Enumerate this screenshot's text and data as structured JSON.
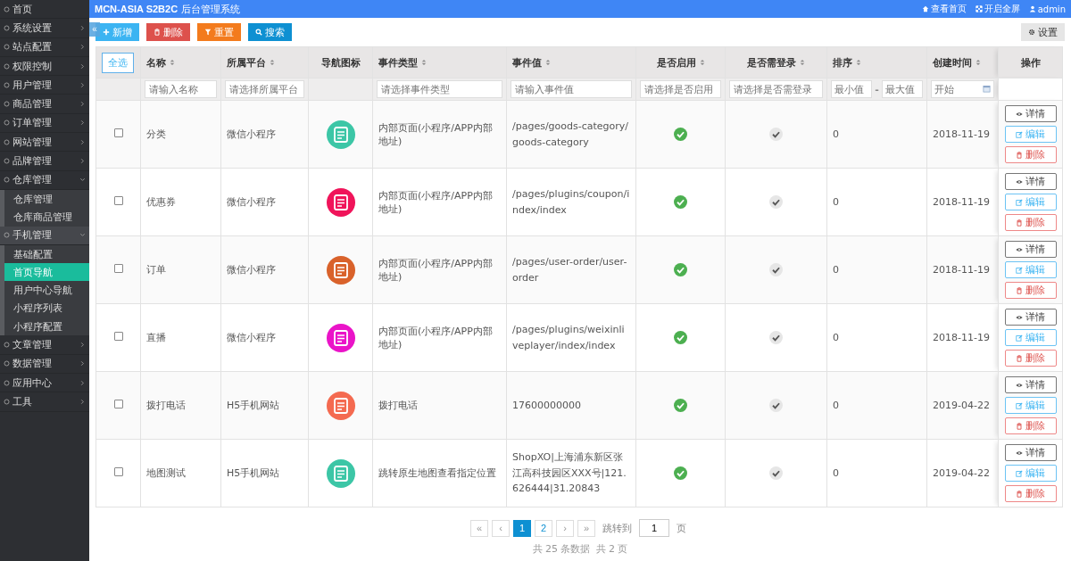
{
  "sidebar": {
    "items": [
      {
        "label": "首页",
        "kind": "link",
        "selected": false,
        "expanded": false
      },
      {
        "label": "系统设置",
        "kind": "group",
        "selected": false,
        "expanded": false
      },
      {
        "label": "站点配置",
        "kind": "group",
        "selected": false,
        "expanded": false
      },
      {
        "label": "权限控制",
        "kind": "group",
        "selected": false,
        "expanded": false
      },
      {
        "label": "用户管理",
        "kind": "group",
        "selected": false,
        "expanded": false
      },
      {
        "label": "商品管理",
        "kind": "group",
        "selected": false,
        "expanded": false
      },
      {
        "label": "订单管理",
        "kind": "group",
        "selected": false,
        "expanded": false
      },
      {
        "label": "网站管理",
        "kind": "group",
        "selected": false,
        "expanded": false
      },
      {
        "label": "品牌管理",
        "kind": "group",
        "selected": false,
        "expanded": false
      },
      {
        "label": "仓库管理",
        "kind": "group",
        "selected": false,
        "expanded": true,
        "children": [
          {
            "label": "仓库管理",
            "selected": false
          },
          {
            "label": "仓库商品管理",
            "selected": false
          }
        ]
      },
      {
        "label": "手机管理",
        "kind": "group",
        "selected": true,
        "expanded": true,
        "children": [
          {
            "label": "基础配置",
            "selected": false
          },
          {
            "label": "首页导航",
            "selected": true
          },
          {
            "label": "用户中心导航",
            "selected": false
          },
          {
            "label": "小程序列表",
            "selected": false
          },
          {
            "label": "小程序配置",
            "selected": false
          }
        ]
      },
      {
        "label": "文章管理",
        "kind": "group",
        "selected": false,
        "expanded": false
      },
      {
        "label": "数据管理",
        "kind": "group",
        "selected": false,
        "expanded": false
      },
      {
        "label": "应用中心",
        "kind": "group",
        "selected": false,
        "expanded": false
      },
      {
        "label": "工具",
        "kind": "group",
        "selected": false,
        "expanded": false
      }
    ]
  },
  "header": {
    "brand": "MCN-ASIA S2B2C",
    "subtitle": "后台管理系统",
    "links": [
      {
        "label": "查看首页",
        "kind": "home"
      },
      {
        "label": "开启全屏",
        "kind": "fullscreen"
      },
      {
        "label": "admin",
        "kind": "user"
      }
    ]
  },
  "toolbar": {
    "collapse": "«",
    "buttons": [
      {
        "label": "新增",
        "kind": "add"
      },
      {
        "label": "删除",
        "kind": "delete"
      },
      {
        "label": "重置",
        "kind": "reset"
      },
      {
        "label": "搜索",
        "kind": "search"
      }
    ],
    "settings": "设置"
  },
  "table": {
    "select_all": "全选",
    "columns": [
      {
        "label": "名称",
        "sortable": true,
        "filter": {
          "kind": "text",
          "placeholder": "请输入名称"
        }
      },
      {
        "label": "所属平台",
        "sortable": true,
        "filter": {
          "kind": "text",
          "placeholder": "请选择所属平台"
        }
      },
      {
        "label": "导航图标",
        "sortable": false,
        "filter": {
          "kind": "none"
        }
      },
      {
        "label": "事件类型",
        "sortable": true,
        "filter": {
          "kind": "text",
          "placeholder": "请选择事件类型"
        }
      },
      {
        "label": "事件值",
        "sortable": true,
        "filter": {
          "kind": "text",
          "placeholder": "请输入事件值"
        }
      },
      {
        "label": "是否启用",
        "sortable": true,
        "filter": {
          "kind": "text",
          "placeholder": "请选择是否启用"
        }
      },
      {
        "label": "是否需登录",
        "sortable": true,
        "filter": {
          "kind": "text",
          "placeholder": "请选择是否需登录"
        }
      },
      {
        "label": "排序",
        "sortable": true,
        "filter": {
          "kind": "range",
          "placeholder": "最小值",
          "placeholder_2": "最大值",
          "separator": "-"
        }
      },
      {
        "label": "创建时间",
        "sortable": true,
        "filter": {
          "kind": "date",
          "placeholder": "开始"
        }
      },
      {
        "label": "操作",
        "sortable": false,
        "filter": {
          "kind": "none"
        }
      }
    ],
    "rows": [
      {
        "checked": false,
        "name": "分类",
        "platform": "微信小程序",
        "color": "#3cc6a6",
        "event_type": "内部页面(小程序/APP内部地址)",
        "event_value": "/pages/goods-category/goods-category",
        "enabled": true,
        "login_required": true,
        "sort": "0",
        "created": "2018-11-19",
        "actions": [
          {
            "label": "详情",
            "kind": "view"
          },
          {
            "label": "编辑",
            "kind": "edit"
          },
          {
            "label": "删除",
            "kind": "delete"
          }
        ]
      },
      {
        "checked": false,
        "name": "优惠券",
        "platform": "微信小程序",
        "color": "#f0145a",
        "event_type": "内部页面(小程序/APP内部地址)",
        "event_value": "/pages/plugins/coupon/index/index",
        "enabled": true,
        "login_required": true,
        "sort": "0",
        "created": "2018-11-19",
        "actions": [
          {
            "label": "详情",
            "kind": "view"
          },
          {
            "label": "编辑",
            "kind": "edit"
          },
          {
            "label": "删除",
            "kind": "delete"
          }
        ]
      },
      {
        "checked": false,
        "name": "订单",
        "platform": "微信小程序",
        "color": "#d9622b",
        "event_type": "内部页面(小程序/APP内部地址)",
        "event_value": "/pages/user-order/user-order",
        "enabled": true,
        "login_required": true,
        "sort": "0",
        "created": "2018-11-19",
        "actions": [
          {
            "label": "详情",
            "kind": "view"
          },
          {
            "label": "编辑",
            "kind": "edit"
          },
          {
            "label": "删除",
            "kind": "delete"
          }
        ]
      },
      {
        "checked": false,
        "name": "直播",
        "platform": "微信小程序",
        "color": "#ea14c8",
        "event_type": "内部页面(小程序/APP内部地址)",
        "event_value": "/pages/plugins/weixinliveplayer/index/index",
        "enabled": true,
        "login_required": true,
        "sort": "0",
        "created": "2018-11-19",
        "actions": [
          {
            "label": "详情",
            "kind": "view"
          },
          {
            "label": "编辑",
            "kind": "edit"
          },
          {
            "label": "删除",
            "kind": "delete"
          }
        ]
      },
      {
        "checked": false,
        "name": "拨打电话",
        "platform": "H5手机网站",
        "color": "#f46a50",
        "event_type": "拨打电话",
        "event_value": "17600000000",
        "enabled": true,
        "login_required": true,
        "sort": "0",
        "created": "2019-04-22",
        "actions": [
          {
            "label": "详情",
            "kind": "view"
          },
          {
            "label": "编辑",
            "kind": "edit"
          },
          {
            "label": "删除",
            "kind": "delete"
          }
        ]
      },
      {
        "checked": false,
        "name": "地图测试",
        "platform": "H5手机网站",
        "color": "#3cc6a6",
        "event_type": "跳转原生地图查看指定位置",
        "event_value": "ShopXO|上海浦东新区张江高科技园区XXX号|121.626444|31.20843",
        "enabled": true,
        "login_required": true,
        "sort": "0",
        "created": "2019-04-22",
        "actions": [
          {
            "label": "详情",
            "kind": "view"
          },
          {
            "label": "编辑",
            "kind": "edit"
          },
          {
            "label": "删除",
            "kind": "delete"
          }
        ]
      }
    ]
  },
  "pagination": {
    "pages": [
      {
        "label": "«",
        "kind": "first",
        "selected": false
      },
      {
        "label": "‹",
        "kind": "prev",
        "selected": false
      },
      {
        "label": "1",
        "kind": "page",
        "selected": true
      },
      {
        "label": "2",
        "kind": "page",
        "selected": false
      },
      {
        "label": "›",
        "kind": "next",
        "selected": false
      },
      {
        "label": "»",
        "kind": "last",
        "selected": false
      }
    ],
    "jump_label": "跳转到",
    "jump_value": "1",
    "jump_unit": "页",
    "total_records": "共 25 条数据",
    "total_pages": "共 2 页"
  }
}
